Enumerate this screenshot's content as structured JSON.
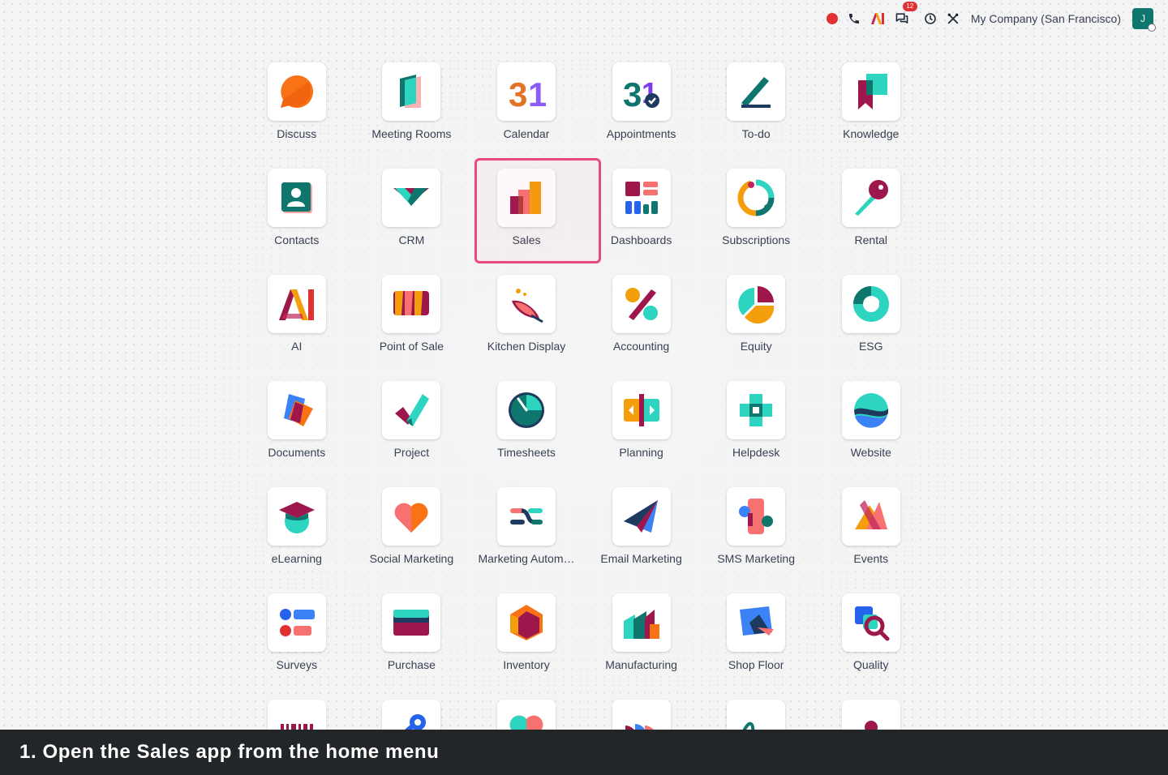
{
  "topbar": {
    "chat_badge_count": "12",
    "company": "My Company (San Francisco)",
    "avatar_initial": "J"
  },
  "apps": [
    {
      "label": "Discuss",
      "icon": "discuss-icon"
    },
    {
      "label": "Meeting Rooms",
      "icon": "meeting-rooms-icon"
    },
    {
      "label": "Calendar",
      "icon": "calendar-icon"
    },
    {
      "label": "Appointments",
      "icon": "appointments-icon"
    },
    {
      "label": "To-do",
      "icon": "todo-icon"
    },
    {
      "label": "Knowledge",
      "icon": "knowledge-icon"
    },
    {
      "label": "Contacts",
      "icon": "contacts-icon"
    },
    {
      "label": "CRM",
      "icon": "crm-icon"
    },
    {
      "label": "Sales",
      "icon": "sales-icon"
    },
    {
      "label": "Dashboards",
      "icon": "dashboards-icon"
    },
    {
      "label": "Subscriptions",
      "icon": "subscriptions-icon"
    },
    {
      "label": "Rental",
      "icon": "rental-icon"
    },
    {
      "label": "AI",
      "icon": "ai-icon"
    },
    {
      "label": "Point of Sale",
      "icon": "point-of-sale-icon"
    },
    {
      "label": "Kitchen Display",
      "icon": "kitchen-display-icon"
    },
    {
      "label": "Accounting",
      "icon": "accounting-icon"
    },
    {
      "label": "Equity",
      "icon": "equity-icon"
    },
    {
      "label": "ESG",
      "icon": "esg-icon"
    },
    {
      "label": "Documents",
      "icon": "documents-icon"
    },
    {
      "label": "Project",
      "icon": "project-icon"
    },
    {
      "label": "Timesheets",
      "icon": "timesheets-icon"
    },
    {
      "label": "Planning",
      "icon": "planning-icon"
    },
    {
      "label": "Helpdesk",
      "icon": "helpdesk-icon"
    },
    {
      "label": "Website",
      "icon": "website-icon"
    },
    {
      "label": "eLearning",
      "icon": "elearning-icon"
    },
    {
      "label": "Social Marketing",
      "icon": "social-marketing-icon"
    },
    {
      "label": "Marketing Autom…",
      "icon": "marketing-automation-icon"
    },
    {
      "label": "Email Marketing",
      "icon": "email-marketing-icon"
    },
    {
      "label": "SMS Marketing",
      "icon": "sms-marketing-icon"
    },
    {
      "label": "Events",
      "icon": "events-icon"
    },
    {
      "label": "Surveys",
      "icon": "surveys-icon"
    },
    {
      "label": "Purchase",
      "icon": "purchase-icon"
    },
    {
      "label": "Inventory",
      "icon": "inventory-icon"
    },
    {
      "label": "Manufacturing",
      "icon": "manufacturing-icon"
    },
    {
      "label": "Shop Floor",
      "icon": "shop-floor-icon"
    },
    {
      "label": "Quality",
      "icon": "quality-icon"
    },
    {
      "label": "",
      "icon": "barcode-icon"
    },
    {
      "label": "",
      "icon": "fleet-icon"
    },
    {
      "label": "",
      "icon": "heart-app-icon"
    },
    {
      "label": "",
      "icon": "studio-icon"
    },
    {
      "label": "",
      "icon": "sign-icon"
    },
    {
      "label": "",
      "icon": "people-icon"
    }
  ],
  "caption": "1. Open the Sales app from the home menu",
  "colors": {
    "highlight": "#e84a7f",
    "caption_bg": "#232629",
    "badge": "#e03131",
    "avatar": "#0f766e"
  }
}
